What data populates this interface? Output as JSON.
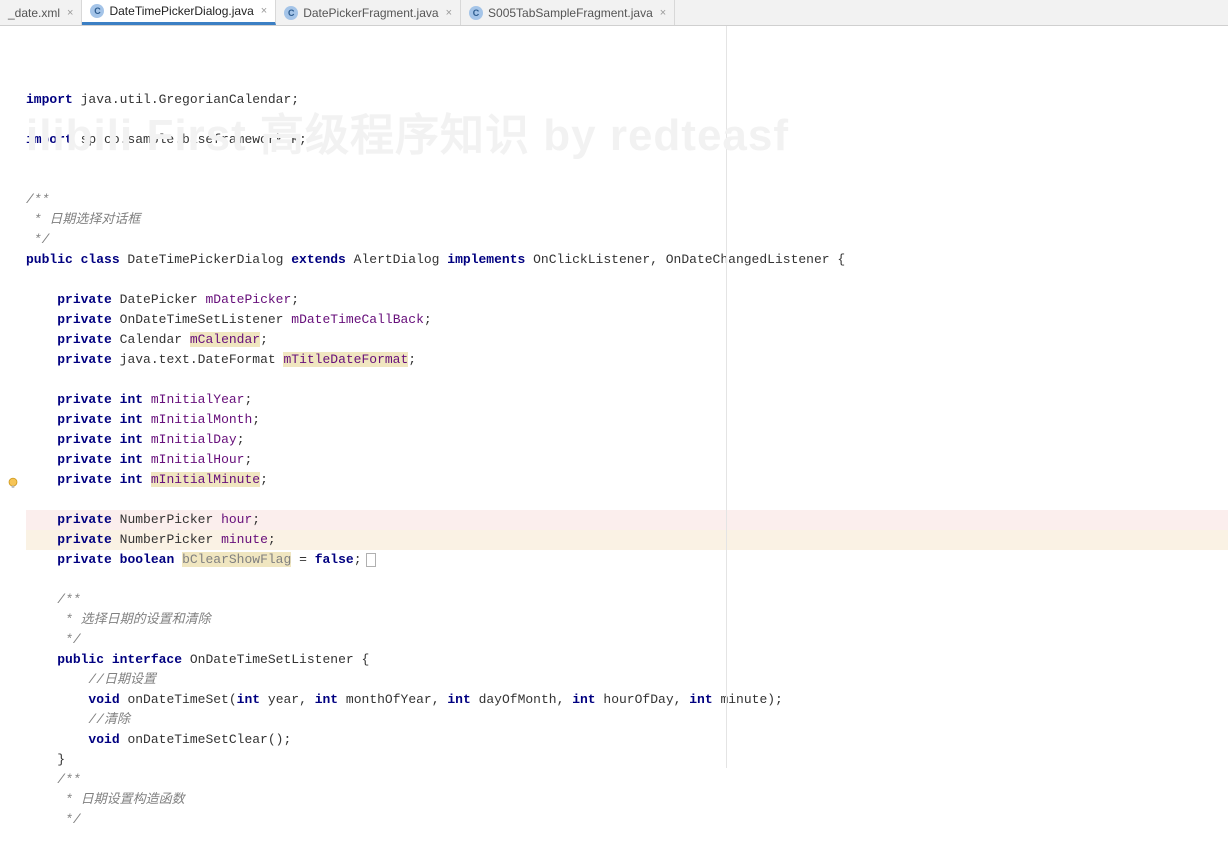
{
  "tabs": [
    {
      "label": "_date.xml",
      "type": "xml",
      "active": false
    },
    {
      "label": "DateTimePickerDialog.java",
      "type": "java",
      "active": true
    },
    {
      "label": "DatePickerFragment.java",
      "type": "java",
      "active": false
    },
    {
      "label": "S005TabSampleFragment.java",
      "type": "java",
      "active": false
    }
  ],
  "watermark": "ilibili First 高级程序知识 by redteasf",
  "code": {
    "import1_kw": "import",
    "import1_rest": " java.util.GregorianCalendar;",
    "import2_kw": "import",
    "import2_rest": " sp.co.sample.baseframework.R;",
    "jdoc_open": "/**",
    "jdoc_line": " * 日期选择对话框",
    "jdoc_close": " */",
    "cls_public": "public ",
    "cls_class": "class ",
    "cls_name": "DateTimePickerDialog ",
    "cls_extends": "extends ",
    "cls_super": "AlertDialog ",
    "cls_impl": "implements ",
    "cls_ifaces": "OnClickListener, OnDateChangedListener {",
    "f_private": "private ",
    "f_int": "int ",
    "f1_type": "DatePicker ",
    "f1_name": "mDatePicker",
    "f2_type": "OnDateTimeSetListener ",
    "f2_name": "mDateTimeCallBack",
    "f3_type": "Calendar ",
    "f3_name": "mCalendar",
    "f4_type": "java.text.DateFormat ",
    "f4_name": "mTitleDateFormat",
    "f5_name": "mInitialYear",
    "f6_name": "mInitialMonth",
    "f7_name": "mInitialDay",
    "f8_name": "mInitialHour",
    "f9_name": "mInitialMinute",
    "np_type": "NumberPicker ",
    "np_hour": "hour",
    "np_minute": "minute",
    "bc_type": "boolean ",
    "bc_name": "bClearShowFlag",
    "bc_eq": " = ",
    "bc_false": "false",
    "semi": ";",
    "jdoc2_open": "/**",
    "jdoc2_line": " * 选择日期的设置和清除",
    "jdoc2_close": " */",
    "iface_public": "public ",
    "iface_kw": "interface ",
    "iface_name": "OnDateTimeSetListener ",
    "iface_brace": "{",
    "cmt_set": "//日期设置",
    "m1_void": "void ",
    "m1_name": "onDateTimeSet",
    "m1_sig_open": "(",
    "m1_p1": "int ",
    "m1_p1n": "year, ",
    "m1_p2": "int ",
    "m1_p2n": "monthOfYear, ",
    "m1_p3": "int ",
    "m1_p3n": "dayOfMonth, ",
    "m1_p4": "int ",
    "m1_p4n": "hourOfDay, ",
    "m1_p5": "int ",
    "m1_p5n": "minute);",
    "cmt_clr": "//清除",
    "m2_void": "void ",
    "m2_name": "onDateTimeSetClear",
    "m2_sig": "();",
    "iface_close": "}",
    "jdoc3_open": "/**",
    "jdoc3_line": " * 日期设置构造函数",
    "jdoc3_close": " */"
  }
}
